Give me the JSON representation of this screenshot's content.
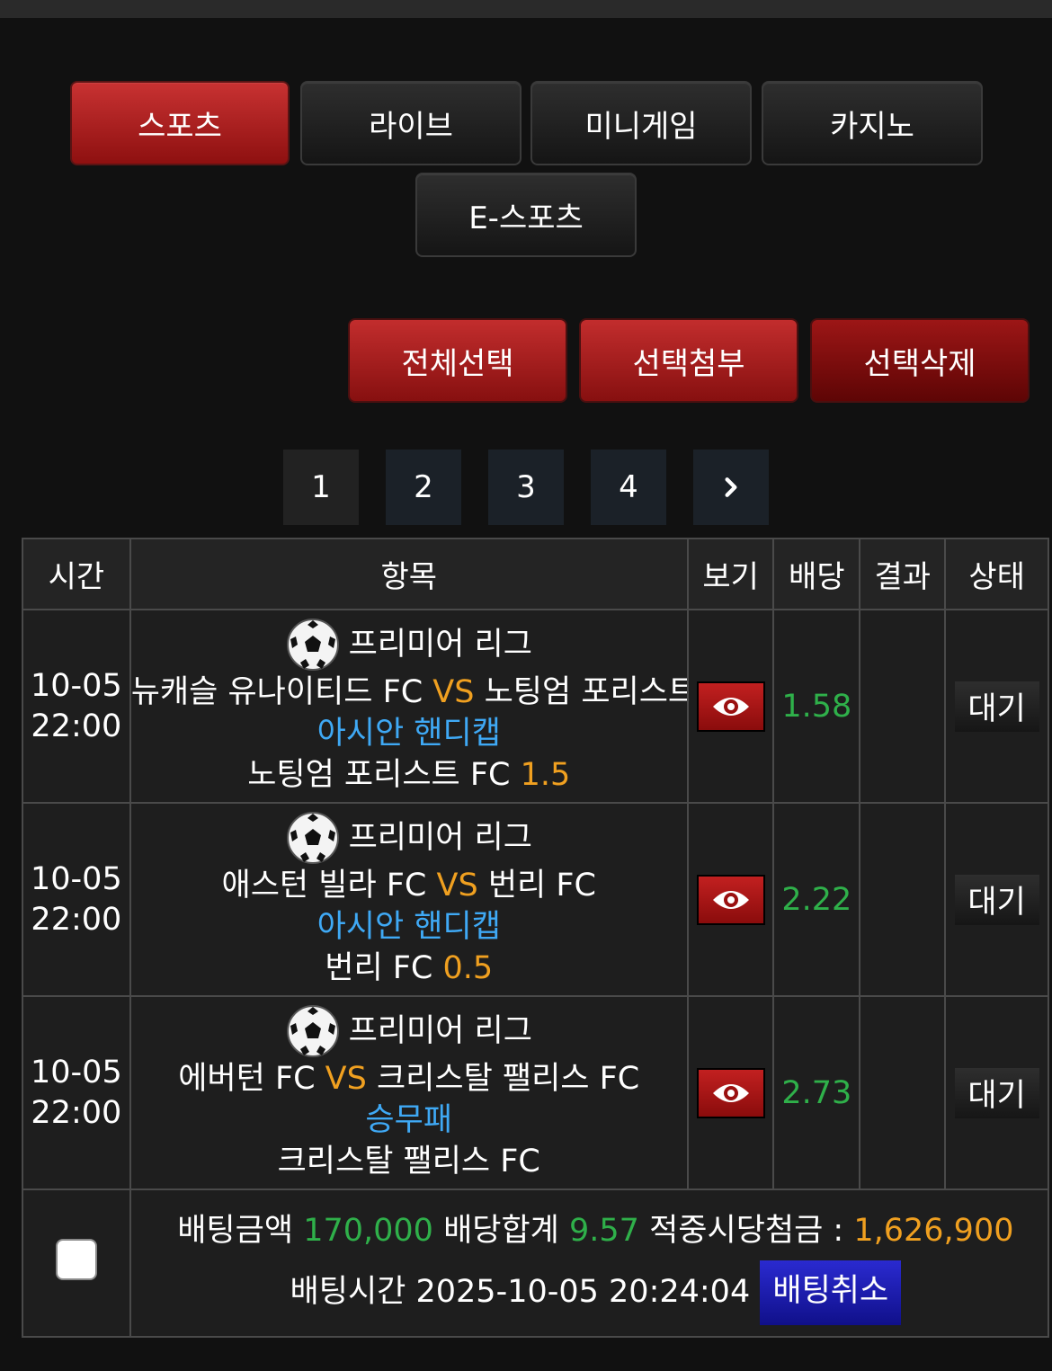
{
  "categories": [
    {
      "label": "스포츠",
      "active": true
    },
    {
      "label": "라이브",
      "active": false
    },
    {
      "label": "미니게임",
      "active": false
    },
    {
      "label": "카지노",
      "active": false
    },
    {
      "label": "E-스포츠",
      "active": false
    }
  ],
  "actions": {
    "select_all": "전체선택",
    "attach_selected": "선택첨부",
    "delete_selected": "선택삭제"
  },
  "pagination": {
    "pages": [
      "1",
      "2",
      "3",
      "4"
    ],
    "current": "1",
    "next_icon": "chevron-right-icon"
  },
  "table": {
    "headers": {
      "time": "시간",
      "item": "항목",
      "view": "보기",
      "odds": "배당",
      "result": "결과",
      "status": "상태"
    },
    "rows": [
      {
        "date": "10-05",
        "time": "22:00",
        "league": "프리미어 리그",
        "sport_icon": "soccer-ball-icon",
        "home": "뉴캐슬 유나이티드 FC",
        "vs": "VS",
        "away": "노팅엄 포리스트 FC",
        "market": "아시안 핸디캡",
        "pick": "노팅엄 포리스트 FC",
        "pick_value": "1.5",
        "odds": "1.58",
        "result": "",
        "status": "대기"
      },
      {
        "date": "10-05",
        "time": "22:00",
        "league": "프리미어 리그",
        "sport_icon": "soccer-ball-icon",
        "home": "애스턴 빌라 FC",
        "vs": "VS",
        "away": "번리 FC",
        "market": "아시안 핸디캡",
        "pick": "번리 FC",
        "pick_value": "0.5",
        "odds": "2.22",
        "result": "",
        "status": "대기"
      },
      {
        "date": "10-05",
        "time": "22:00",
        "league": "프리미어 리그",
        "sport_icon": "soccer-ball-icon",
        "home": "에버턴 FC",
        "vs": "VS",
        "away": "크리스탈 팰리스 FC",
        "market": "승무패",
        "pick": "크리스탈 팰리스 FC",
        "pick_value": "",
        "odds": "2.73",
        "result": "",
        "status": "대기"
      }
    ]
  },
  "summary": {
    "bet_amount_label": "배팅금액",
    "bet_amount": "170,000",
    "total_odds_label": "배당합계",
    "total_odds": "9.57",
    "payout_label": "적중시당첨금 :",
    "payout": "1,626,900",
    "bet_time_label": "배팅시간",
    "bet_time": "2025-10-05 20:24:04",
    "cancel_label": "배팅취소"
  },
  "colors": {
    "accent_red": "#b81f1f",
    "odds_green": "#2fb04a",
    "vs_orange": "#f0a020",
    "market_blue": "#3fa9f5",
    "cancel_blue": "#1a1ab0"
  }
}
